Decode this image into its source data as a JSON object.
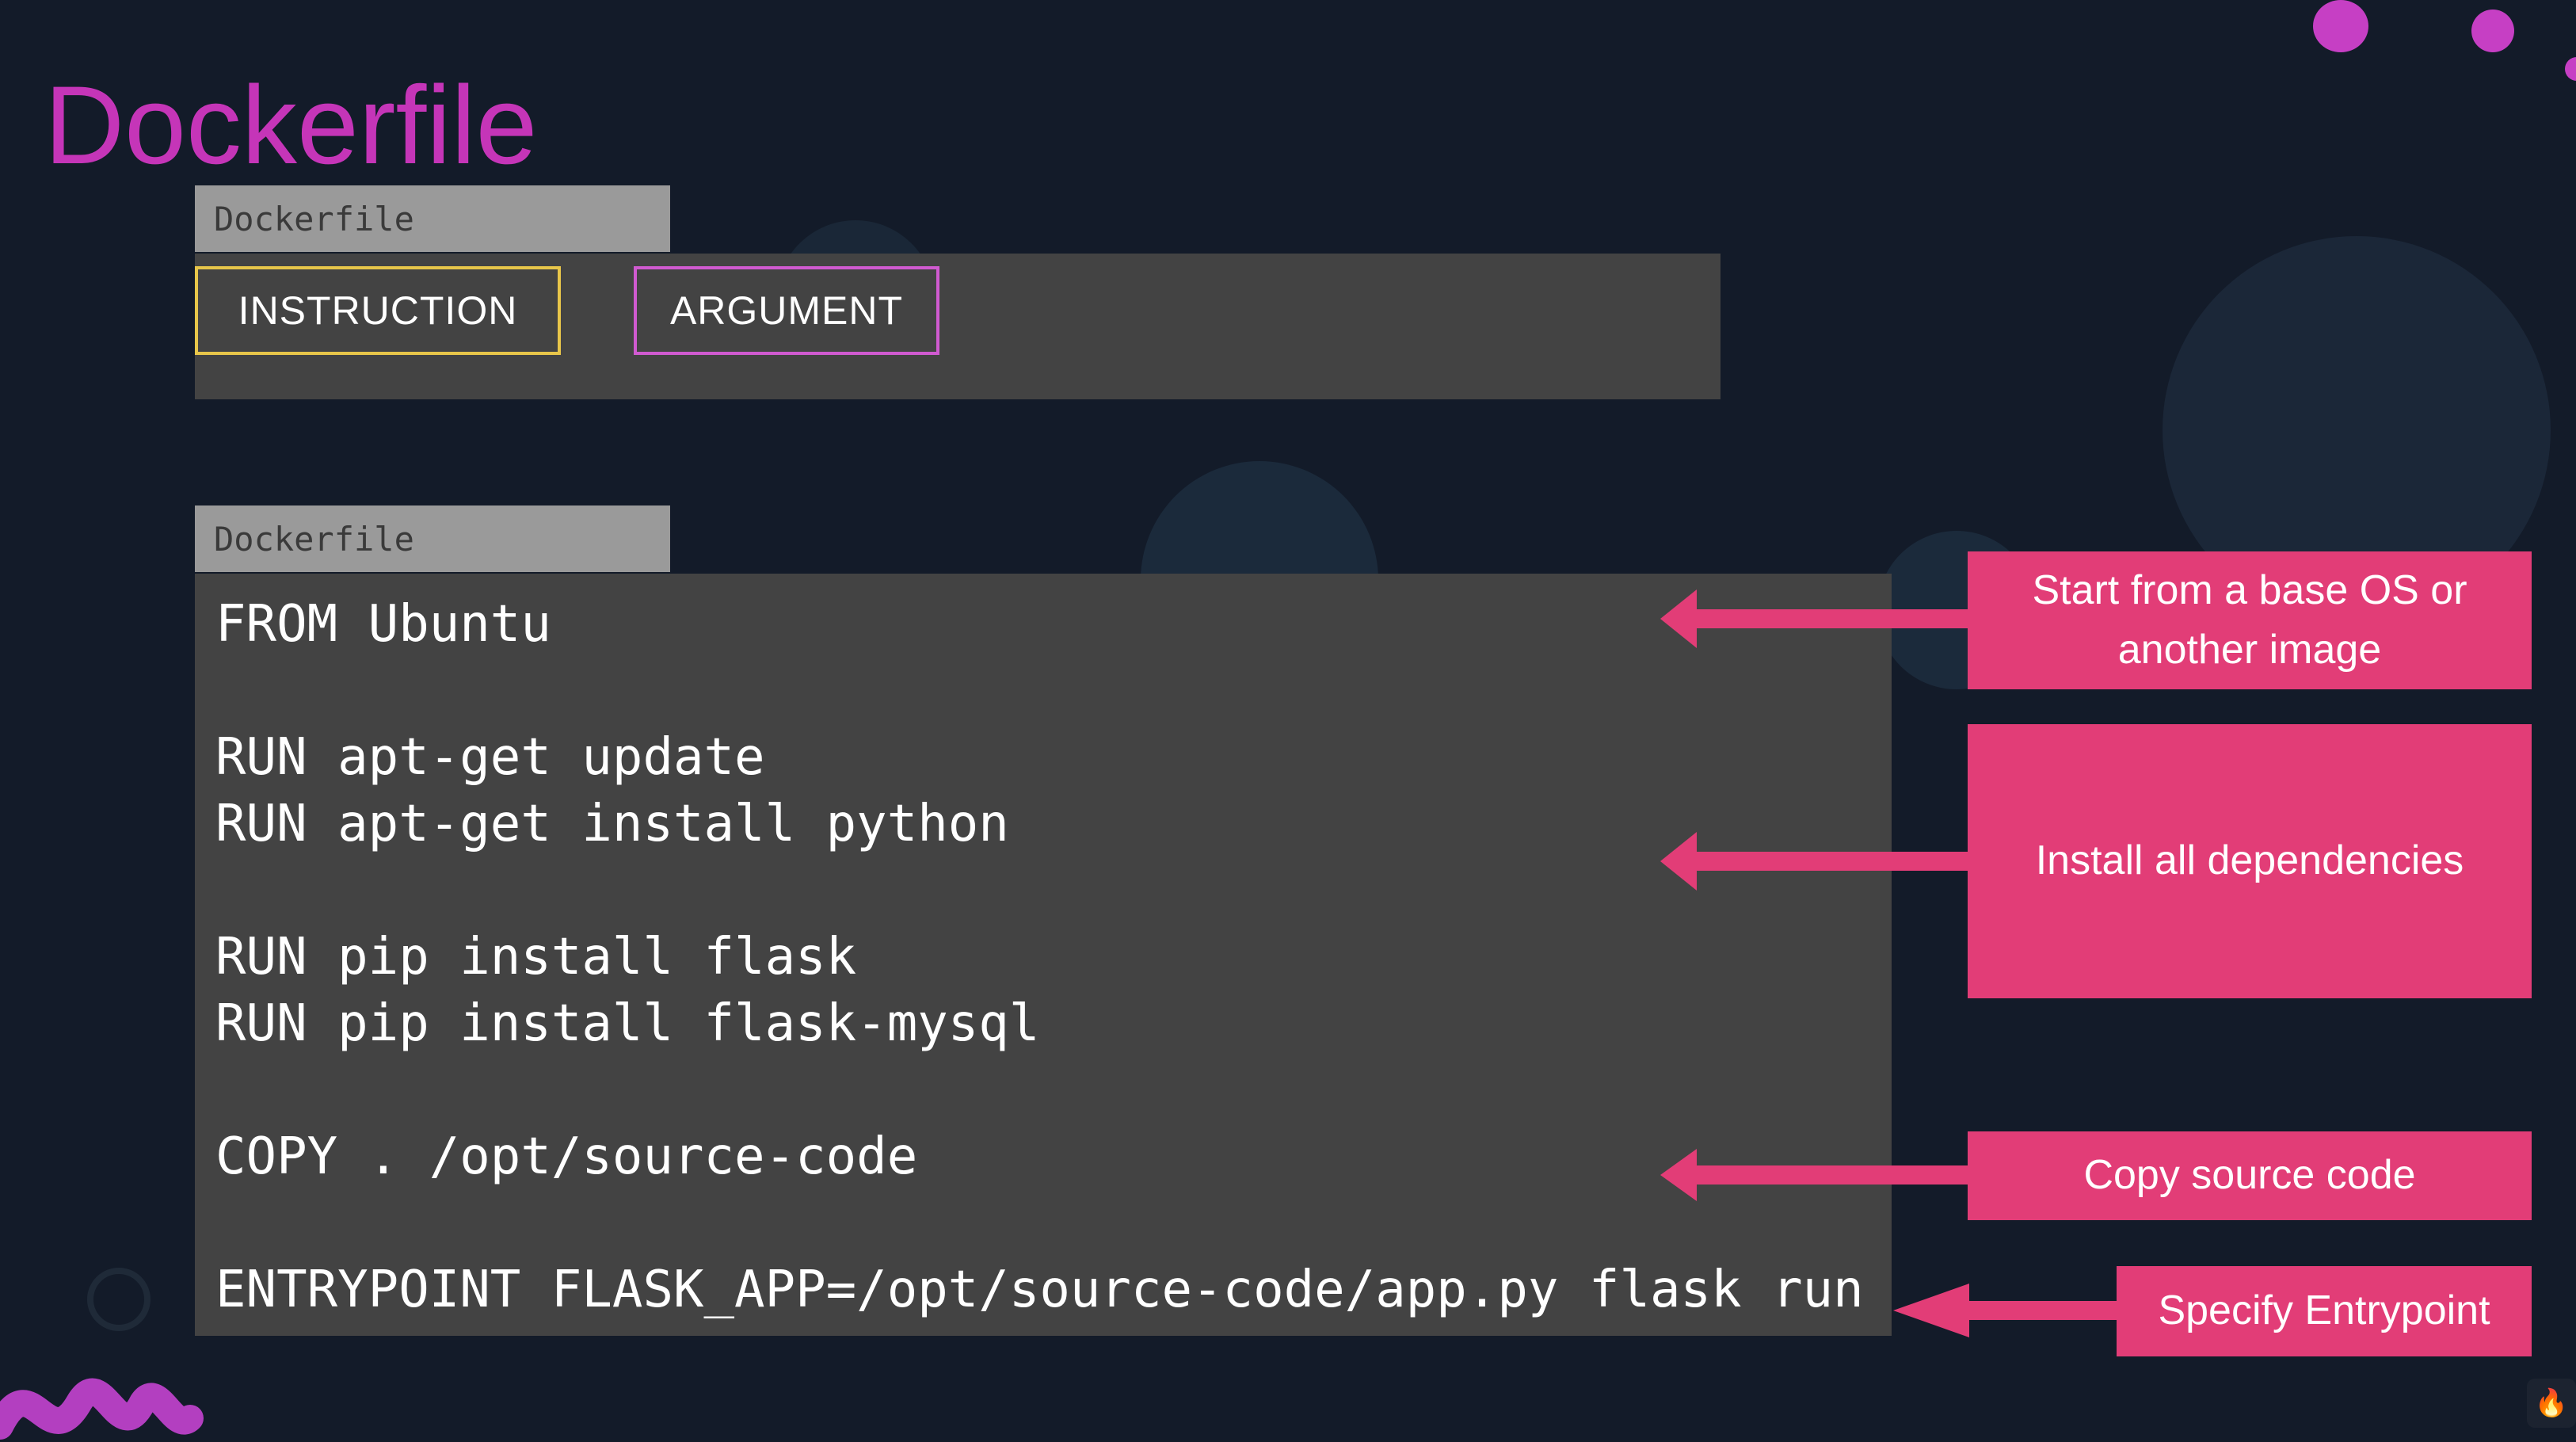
{
  "slide": {
    "title": "Dockerfile"
  },
  "format_example": {
    "tab_label": "Dockerfile",
    "instruction_label": "INSTRUCTION",
    "argument_label": "ARGUMENT"
  },
  "code_example": {
    "tab_label": "Dockerfile",
    "lines": [
      "FROM Ubuntu",
      "RUN apt-get update",
      "RUN apt-get install python",
      "RUN pip install flask",
      "RUN pip install flask-mysql",
      "COPY . /opt/source-code",
      "ENTRYPOINT FLASK_APP=/opt/source-code/app.py flask run"
    ]
  },
  "callouts": {
    "base_os": "Start from a base OS or another image",
    "dependencies": "Install all dependencies",
    "copy_source": "Copy source code",
    "entrypoint": "Specify Entrypoint"
  },
  "colors": {
    "title": "#c535b8",
    "callout": "#e23d77",
    "instruction_border": "#e8c64a",
    "argument_border": "#d05ad0"
  },
  "icons": [
    "decorative-circle",
    "squiggle-decoration",
    "flame-logo-icon"
  ]
}
